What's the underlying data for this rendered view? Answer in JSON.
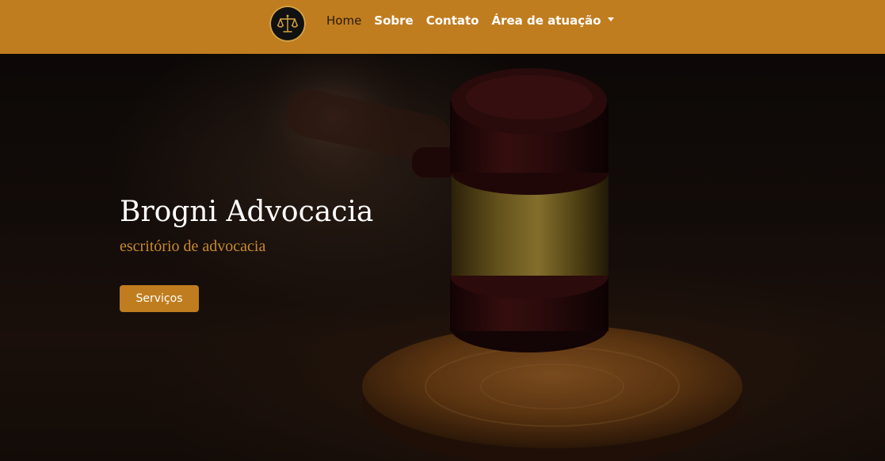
{
  "navbar": {
    "logo_icon": "scales-of-justice-icon",
    "links": [
      {
        "label": "Home",
        "active": true
      },
      {
        "label": "Sobre"
      },
      {
        "label": "Contato"
      },
      {
        "label": "Área de atuação",
        "dropdown": true
      }
    ],
    "background_color": "#c07d1f"
  },
  "hero": {
    "title": "Brogni Advocacia",
    "subtitle": "escritório de advocacia",
    "button_label": "Serviços",
    "background_image": "judge-gavel-photo",
    "accent_color": "#c98a2c"
  }
}
